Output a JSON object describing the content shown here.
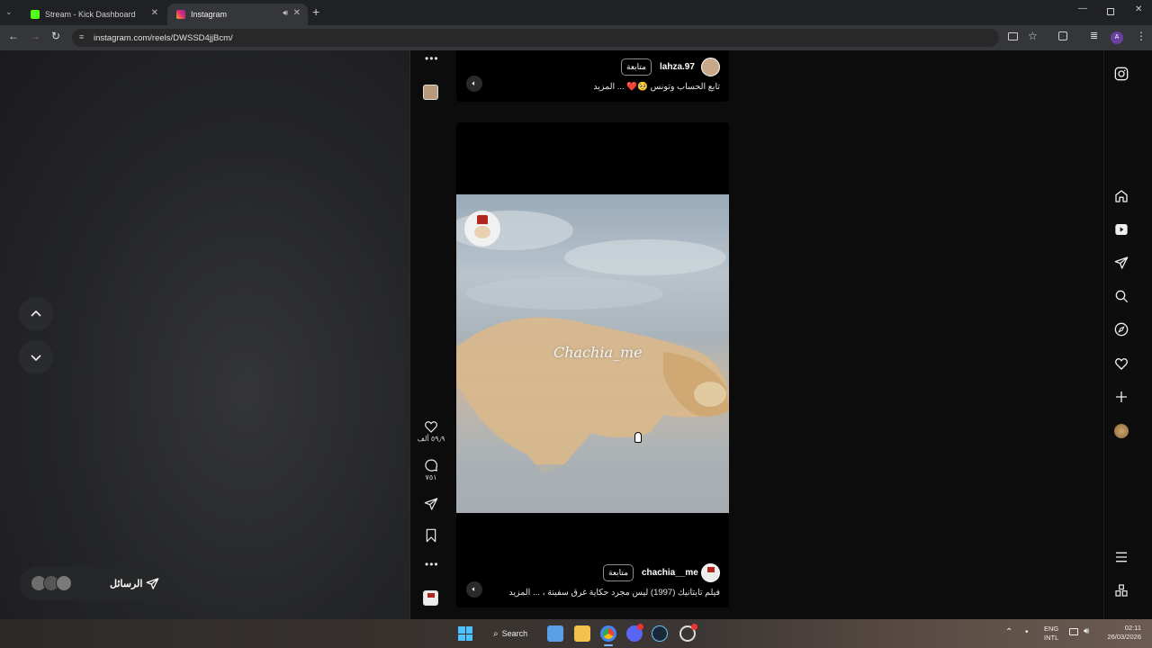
{
  "browser": {
    "tabs": [
      {
        "label": "Stream - Kick Dashboard",
        "color": "#53fc18"
      },
      {
        "label": "Instagram",
        "color": "#e1306c"
      }
    ],
    "url": "instagram.com/reels/DWSSD4jjBcm/"
  },
  "reels": [
    {
      "username": "lahza.97",
      "follow_label": "متابعة",
      "caption": "تابع الحساب وتونس 🥺❤️ ... المزيد"
    },
    {
      "username": "chachia__me",
      "follow_label": "متابعة",
      "caption": "فيلم تايتانيك (1997) ليس مجرد حكاية غرق سفينة ، ... المزيد",
      "watermark": "Chachia_me",
      "likes": "٥٩٫٩ ألف",
      "comments": "٧٥١"
    }
  ],
  "messages": {
    "label": "الرسائل"
  },
  "taskbar": {
    "search_label": "Search",
    "lang_line1": "ENG",
    "lang_line2": "INTL",
    "time": "02:11",
    "date": "26/03/2026"
  },
  "icons": {
    "right_nav": [
      "instagram-logo-icon",
      "home-icon",
      "reels-icon",
      "send-icon",
      "search-icon",
      "explore-icon",
      "heart-icon",
      "create-icon",
      "profile-avatar",
      "menu-icon",
      "apps-icon"
    ]
  }
}
